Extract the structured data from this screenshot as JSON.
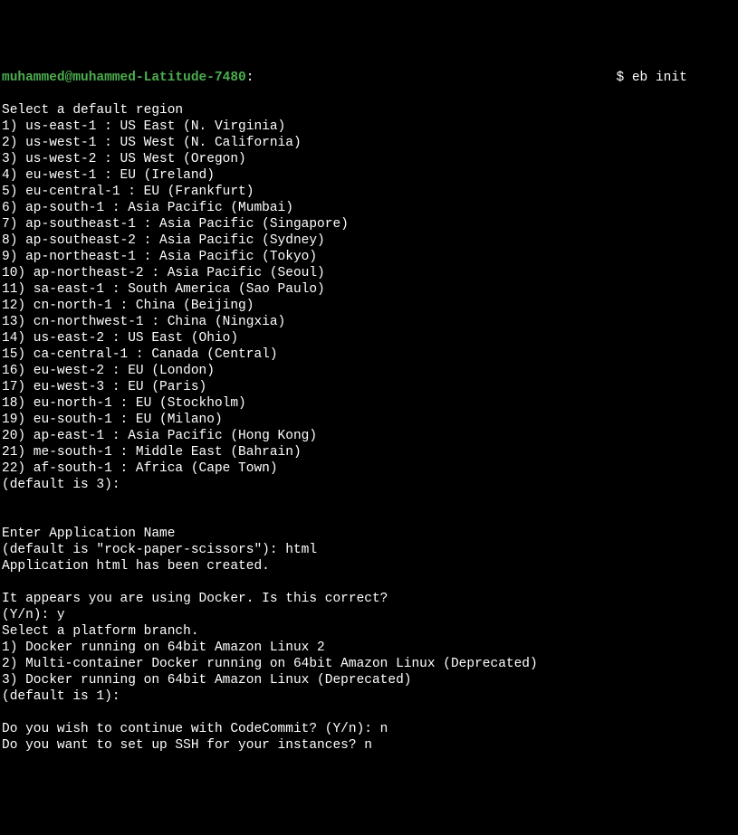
{
  "prompt": {
    "user_host": "muhammed@muhammed-Latitude-7480",
    "separator": ":",
    "dollar": "$ ",
    "command": "eb init"
  },
  "region_header": "Select a default region",
  "regions": [
    "1) us-east-1 : US East (N. Virginia)",
    "2) us-west-1 : US West (N. California)",
    "3) us-west-2 : US West (Oregon)",
    "4) eu-west-1 : EU (Ireland)",
    "5) eu-central-1 : EU (Frankfurt)",
    "6) ap-south-1 : Asia Pacific (Mumbai)",
    "7) ap-southeast-1 : Asia Pacific (Singapore)",
    "8) ap-southeast-2 : Asia Pacific (Sydney)",
    "9) ap-northeast-1 : Asia Pacific (Tokyo)",
    "10) ap-northeast-2 : Asia Pacific (Seoul)",
    "11) sa-east-1 : South America (Sao Paulo)",
    "12) cn-north-1 : China (Beijing)",
    "13) cn-northwest-1 : China (Ningxia)",
    "14) us-east-2 : US East (Ohio)",
    "15) ca-central-1 : Canada (Central)",
    "16) eu-west-2 : EU (London)",
    "17) eu-west-3 : EU (Paris)",
    "18) eu-north-1 : EU (Stockholm)",
    "19) eu-south-1 : EU (Milano)",
    "20) ap-east-1 : Asia Pacific (Hong Kong)",
    "21) me-south-1 : Middle East (Bahrain)",
    "22) af-south-1 : Africa (Cape Town)"
  ],
  "region_default": "(default is 3):",
  "blank": "",
  "app_name_header": "Enter Application Name",
  "app_name_default": "(default is \"rock-paper-scissors\"): html",
  "app_created": "Application html has been created.",
  "docker_detect": "It appears you are using Docker. Is this correct?",
  "docker_answer": "(Y/n): y",
  "platform_header": "Select a platform branch.",
  "platforms": [
    "1) Docker running on 64bit Amazon Linux 2",
    "2) Multi-container Docker running on 64bit Amazon Linux (Deprecated)",
    "3) Docker running on 64bit Amazon Linux (Deprecated)"
  ],
  "platform_default": "(default is 1):",
  "codecommit": "Do you wish to continue with CodeCommit? (Y/n): n",
  "ssh": "Do you want to set up SSH for your instances? n"
}
